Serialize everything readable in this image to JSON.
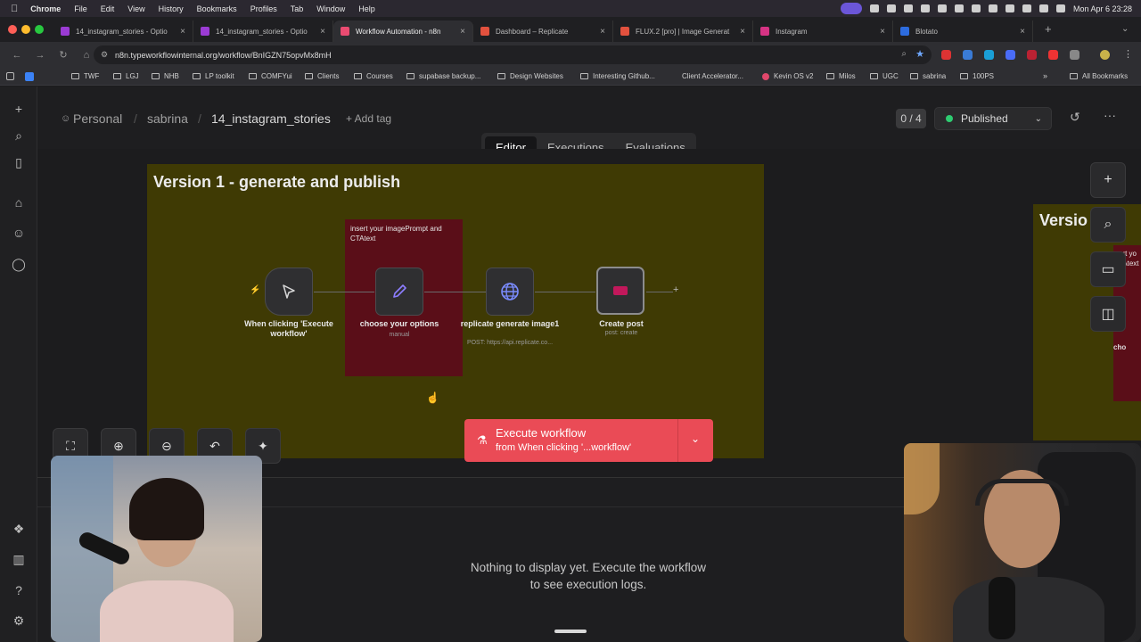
{
  "menubar": {
    "app": "Chrome",
    "items": [
      "File",
      "Edit",
      "View",
      "History",
      "Bookmarks",
      "Profiles",
      "Tab",
      "Window",
      "Help"
    ],
    "clock": "Mon Apr 6  23:28"
  },
  "tabs": [
    {
      "label": "14_instagram_stories - Optio",
      "color": "#9b3bd4"
    },
    {
      "label": "14_instagram_stories - Optio",
      "color": "#9b3bd4"
    },
    {
      "label": "Workflow Automation - n8n",
      "color": "#ea4b71"
    },
    {
      "label": "Dashboard – Replicate",
      "color": "#e2513e"
    },
    {
      "label": "FLUX.2 [pro] | Image Generat",
      "color": "#e2513e"
    },
    {
      "label": "Instagram",
      "color": "#d63384"
    },
    {
      "label": "Blotato",
      "color": "#2d6cdf"
    }
  ],
  "address": {
    "url": "n8n.typeworkflowinternal.org/workflow/BnIGZN75opvMx8mH"
  },
  "bookmarks": {
    "items": [
      "TWF",
      "LGJ",
      "NHB",
      "LP toolkit",
      "COMFYui",
      "Clients",
      "Courses",
      "supabase backup...",
      "Design Websites",
      "Interesting Github...",
      "Client Accelerator...",
      "Kevin OS v2",
      "Milos",
      "UGC",
      "sabrina",
      "100PS"
    ],
    "all": "All Bookmarks"
  },
  "header": {
    "project": "Personal",
    "folder": "sabrina",
    "workflow": "14_instagram_stories",
    "add_tag": "+ Add tag",
    "counter": "0 / 4",
    "status": "Published"
  },
  "tabs_editor": {
    "editor": "Editor",
    "executions": "Executions",
    "evaluations": "Evaluations"
  },
  "canvas": {
    "sticky1_title": "Version 1 - generate and publish",
    "sticky2_title": "Versio",
    "red_note": "insert your imagePrompt and CTAtext",
    "red_note_partial": "ert yo\nTAtext",
    "nodes": [
      {
        "label": "When clicking 'Execute workflow'",
        "sub": ""
      },
      {
        "label": "choose your options",
        "sub": "manual"
      },
      {
        "label": "replicate generate image1",
        "sub": "POST: https://api.replicate.co..."
      },
      {
        "label": "Create post",
        "sub": "post: create"
      }
    ],
    "partial_node_label": "cho"
  },
  "execute": {
    "title": "Execute workflow",
    "subtitle": "from When clicking '...workflow'"
  },
  "logs": {
    "empty": "Nothing to display yet. Execute the workflow to see execution logs."
  },
  "colors": {
    "accent": "#ea4b56",
    "published_dot": "#2ecc71",
    "sticky_yellow": "#3f3a04",
    "sticky_red": "#5a0e18"
  }
}
